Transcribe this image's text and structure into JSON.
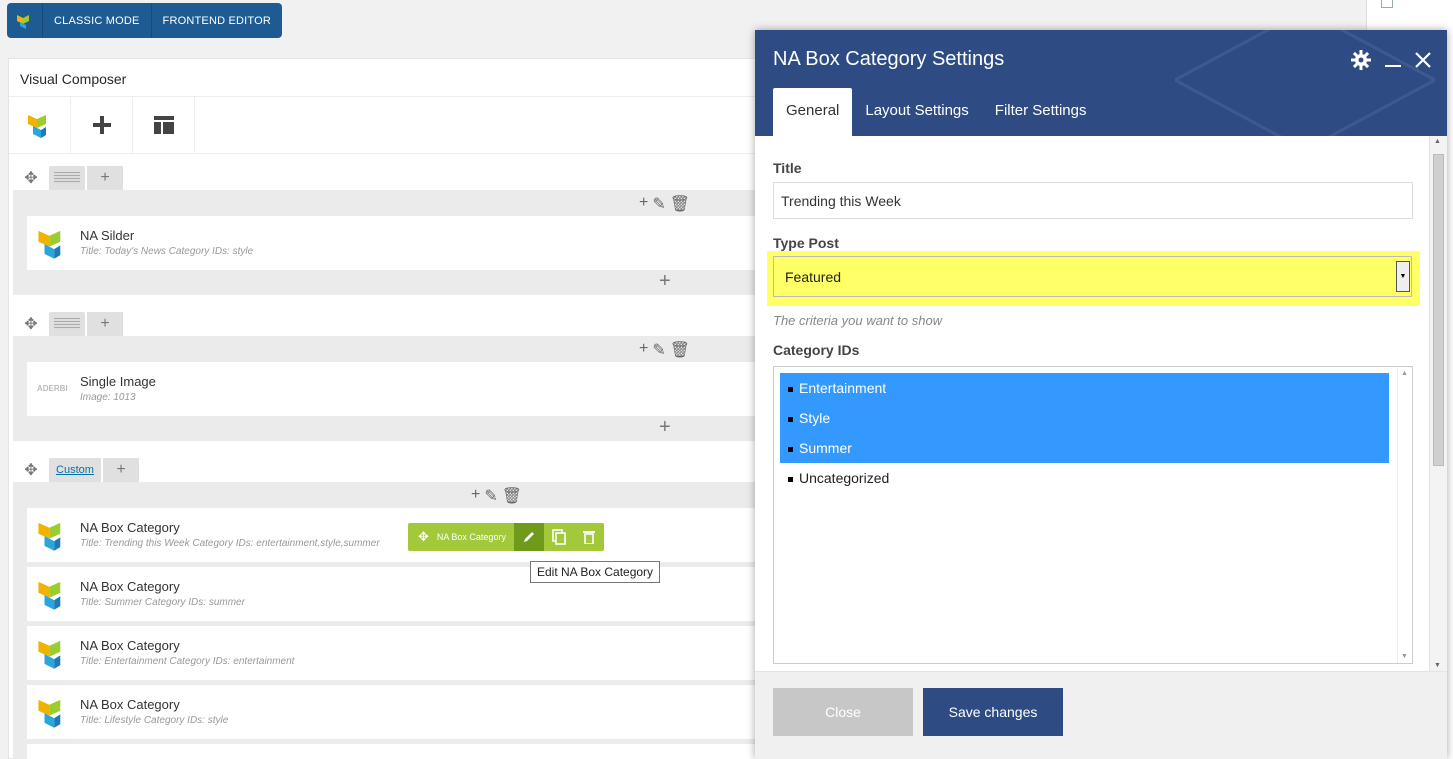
{
  "topbar": {
    "classic_mode": "CLASSIC MODE",
    "frontend_editor": "FRONTEND EDITOR"
  },
  "panel": {
    "title": "Visual Composer"
  },
  "rows": [
    {
      "element": {
        "title": "NA Silder",
        "subtitle": "Title: Today's News  Category IDs: style"
      }
    },
    {
      "element": {
        "title": "Single Image",
        "subtitle": "Image: 1013"
      },
      "thumb_text": "ADERBI"
    },
    {
      "tab_label": "Custom",
      "elements": [
        {
          "title": "NA Box Category",
          "subtitle": "Title: Trending this Week  Category IDs: entertainment,style,summer"
        },
        {
          "title": "NA Box Category",
          "subtitle": "Title: Summer  Category IDs: summer"
        },
        {
          "title": "NA Box Category",
          "subtitle": "Title: Entertainment  Category IDs: entertainment"
        },
        {
          "title": "NA Box Category",
          "subtitle": "Title: Lifestyle  Category IDs: style"
        }
      ]
    }
  ],
  "hover_bar": {
    "label": "NA Box Category"
  },
  "tooltip": {
    "text": "Edit NA Box Category"
  },
  "modal": {
    "title": "NA Box Category Settings",
    "tabs": [
      {
        "label": "General",
        "active": true
      },
      {
        "label": "Layout Settings",
        "active": false
      },
      {
        "label": "Filter Settings",
        "active": false
      }
    ],
    "fields": {
      "title_label": "Title",
      "title_value": "Trending this Week",
      "type_post_label": "Type Post",
      "type_post_value": "Featured",
      "type_post_hint": "The criteria you want to show",
      "category_label": "Category IDs",
      "category_options": [
        {
          "label": "Entertainment",
          "selected": true
        },
        {
          "label": "Style",
          "selected": true
        },
        {
          "label": "Summer",
          "selected": true
        },
        {
          "label": "Uncategorized",
          "selected": false
        }
      ]
    },
    "footer": {
      "close_label": "Close",
      "save_label": "Save changes"
    }
  },
  "colors": {
    "modal_header": "#2e4b83",
    "highlight": "#ffff66",
    "selection": "#3399ff",
    "hover_bar": "#a3c93a"
  },
  "icons": [
    "vc-logo-icon",
    "plus-icon",
    "layout-icon",
    "move-icon",
    "pencil-icon",
    "trash-icon",
    "clone-icon",
    "gear-icon",
    "minimize-icon",
    "close-icon",
    "dropdown-arrow-icon"
  ]
}
